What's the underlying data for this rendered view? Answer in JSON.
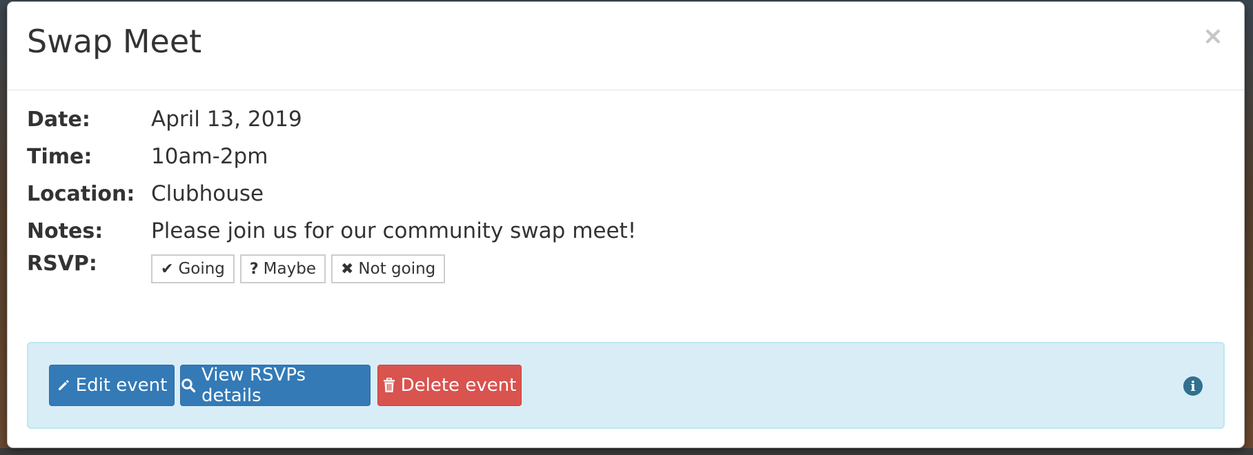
{
  "modal": {
    "title": "Swap Meet",
    "close_glyph": "×"
  },
  "details": [
    {
      "label": "Date:",
      "value": "April 13, 2019"
    },
    {
      "label": "Time:",
      "value": "10am-2pm"
    },
    {
      "label": "Location:",
      "value": "Clubhouse"
    },
    {
      "label": "Notes:",
      "value": "Please join us for our community swap meet!"
    }
  ],
  "rsvp": {
    "label": "RSVP:",
    "options": [
      {
        "label": "Going",
        "icon": "check-icon",
        "glyph": "✔"
      },
      {
        "label": "Maybe",
        "icon": "question-icon",
        "glyph": "?"
      },
      {
        "label": "Not going",
        "icon": "times-icon",
        "glyph": "✖"
      }
    ]
  },
  "actions": {
    "edit": {
      "label": "Edit event",
      "icon": "pencil-icon"
    },
    "view_rsvps": {
      "label": "View RSVPs details",
      "icon": "search-icon"
    },
    "delete": {
      "label": "Delete event",
      "icon": "trash-icon"
    },
    "info_icon": "info-circle-icon",
    "info_glyph": "i"
  },
  "colors": {
    "primary": "#337ab7",
    "danger": "#d9534f",
    "info_panel_bg": "#d9edf7",
    "info_panel_border": "#bce8f1",
    "info_icon": "#31708f",
    "text": "#333333"
  }
}
